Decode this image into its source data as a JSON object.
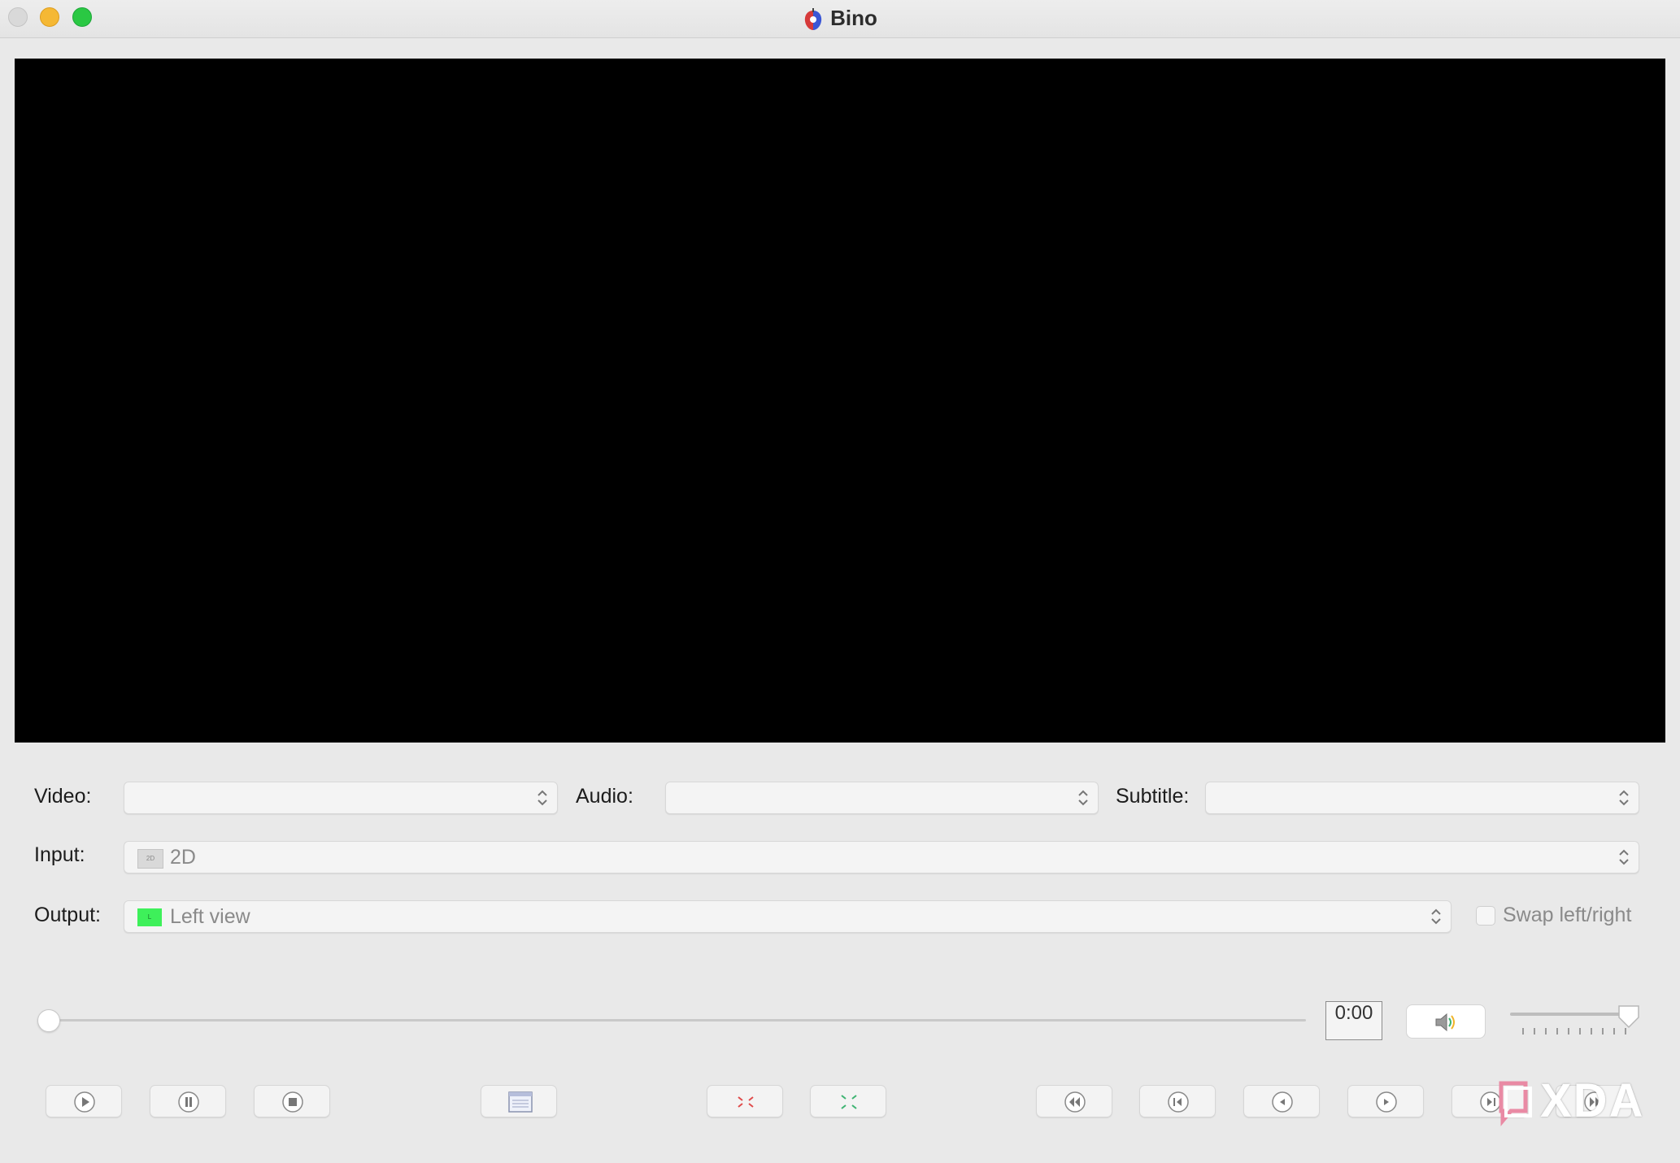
{
  "window": {
    "title": "Bino",
    "traffic_lights": [
      "close",
      "minimize",
      "maximize"
    ]
  },
  "controls": {
    "video_label": "Video:",
    "video_value": "",
    "audio_label": "Audio:",
    "audio_value": "",
    "subtitle_label": "Subtitle:",
    "subtitle_value": "",
    "input_label": "Input:",
    "input_value": "2D",
    "input_icon_text": "2D",
    "output_label": "Output:",
    "output_value": "Left view",
    "output_icon_text": "L",
    "swap_label": "Swap left/right",
    "swap_checked": false
  },
  "playback": {
    "position_fraction": 0.0,
    "time": "0:00",
    "volume_fraction": 1.0
  },
  "toolbar": {
    "buttons": [
      "play",
      "pause",
      "stop",
      "fullscreen",
      "zoom-out",
      "zoom-in",
      "seek-back-10min",
      "seek-back-1min",
      "seek-back-10s",
      "seek-forward-10s",
      "seek-forward-1min",
      "seek-forward-10min"
    ]
  },
  "colors": {
    "output_swatch": "#3ef05a",
    "accent_green": "#2ac843",
    "accent_yellow": "#f5b834",
    "zoom_out_red": "#e04a4a",
    "zoom_in_green": "#3cb371"
  },
  "watermark": {
    "text": "XDA"
  }
}
